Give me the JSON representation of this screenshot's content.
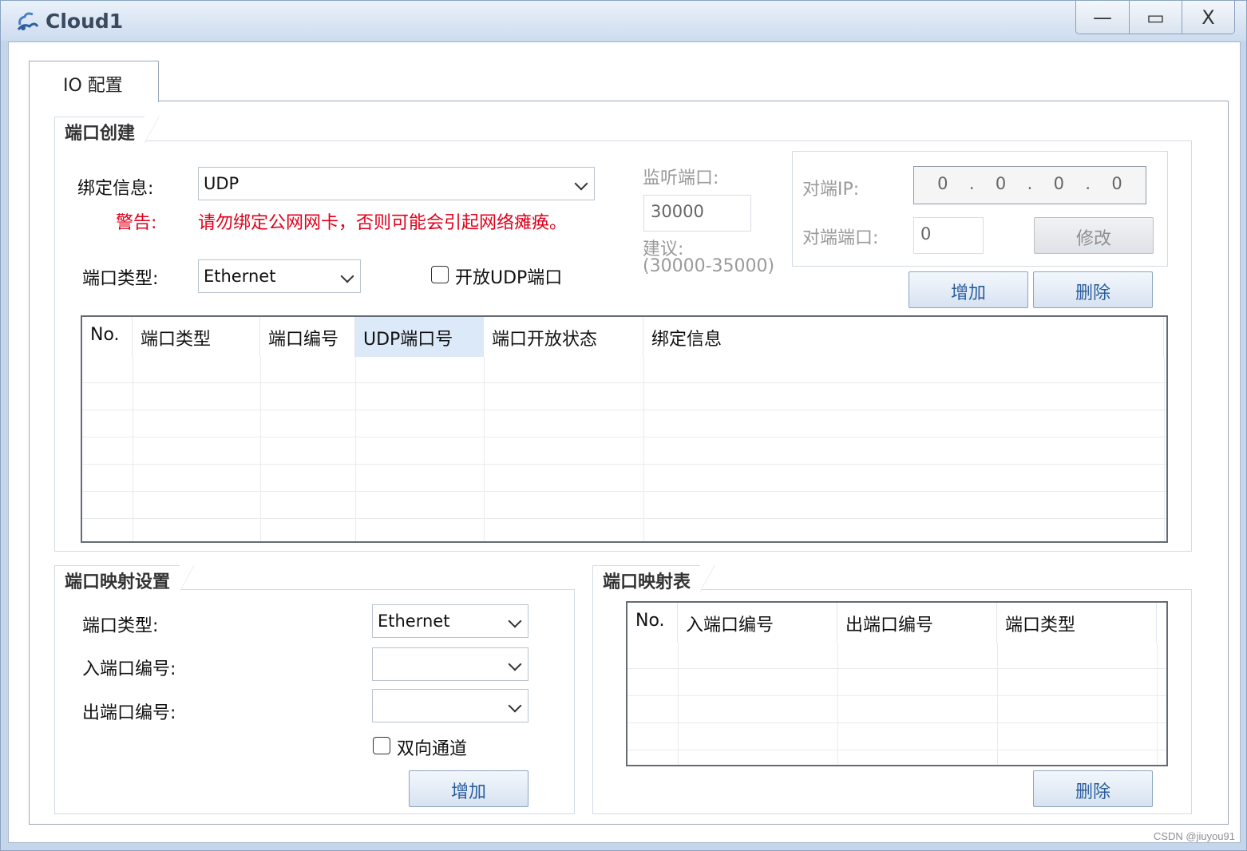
{
  "window": {
    "title": "Cloud1",
    "minimize_glyph": "—",
    "maximize_glyph": "▭",
    "close_glyph": "X"
  },
  "tab": {
    "label": "IO 配置"
  },
  "port_create": {
    "title": "端口创建",
    "bind_label": "绑定信息:",
    "bind_value": "UDP",
    "warning_label": "警告:",
    "warning_text": "请勿绑定公网网卡，否则可能会引起网络瘫痪。",
    "port_type_label": "端口类型:",
    "port_type_value": "Ethernet",
    "open_udp_label": "开放UDP端口",
    "listen_port_label": "监听端口:",
    "listen_port_value": "30000",
    "suggest_label": "建议:",
    "suggest_range": "(30000-35000)",
    "peer_ip_label": "对端IP:",
    "peer_ip_octets": [
      "0",
      "0",
      "0",
      "0"
    ],
    "peer_port_label": "对端端口:",
    "peer_port_value": "0",
    "modify_button": "修改",
    "add_button": "增加",
    "delete_button": "删除",
    "table_columns": [
      "No.",
      "端口类型",
      "端口编号",
      "UDP端口号",
      "端口开放状态",
      "绑定信息"
    ]
  },
  "port_mapping": {
    "title": "端口映射设置",
    "port_type_label": "端口类型:",
    "port_type_value": "Ethernet",
    "in_port_label": "入端口编号:",
    "in_port_value": "",
    "out_port_label": "出端口编号:",
    "out_port_value": "",
    "bidirectional_label": "双向通道",
    "add_button": "增加"
  },
  "mapping_table": {
    "title": "端口映射表",
    "table_columns": [
      "No.",
      "入端口编号",
      "出端口编号",
      "端口类型"
    ],
    "delete_button": "删除"
  },
  "watermark": "CSDN @jiuyou91"
}
